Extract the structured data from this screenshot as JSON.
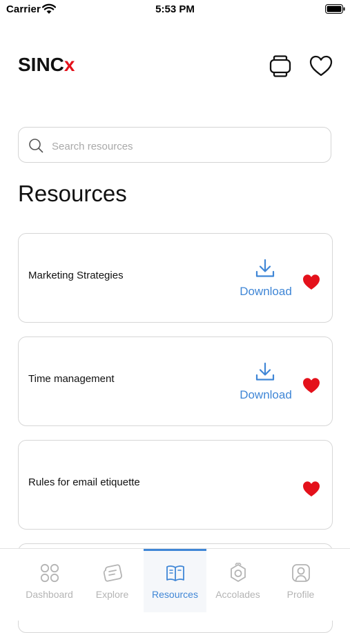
{
  "status_bar": {
    "carrier": "Carrier",
    "time": "5:53 PM"
  },
  "header": {
    "logo_text": "SINC",
    "logo_arrow": "x",
    "icons": [
      "watch-icon",
      "heart-outline-icon"
    ]
  },
  "search": {
    "placeholder": "Search resources",
    "value": ""
  },
  "page_title": "Resources",
  "resources": [
    {
      "title": "Marketing Strategies",
      "download_label": "Download",
      "favorite": true
    },
    {
      "title": "Time management",
      "download_label": "Download",
      "favorite": true
    },
    {
      "title": "Rules for email etiquette",
      "download_label": "",
      "favorite": true
    }
  ],
  "tabs": [
    {
      "label": "Dashboard",
      "icon": "grid-icon",
      "active": false
    },
    {
      "label": "Explore",
      "icon": "explore-icon",
      "active": false
    },
    {
      "label": "Resources",
      "icon": "book-icon",
      "active": true
    },
    {
      "label": "Accolades",
      "icon": "badge-icon",
      "active": false
    },
    {
      "label": "Profile",
      "icon": "profile-icon",
      "active": false
    }
  ],
  "colors": {
    "accent": "#3f86d6",
    "favorite": "#e4111b",
    "logo_accent": "#e4111b",
    "inactive_tab": "#b4b4b4"
  }
}
